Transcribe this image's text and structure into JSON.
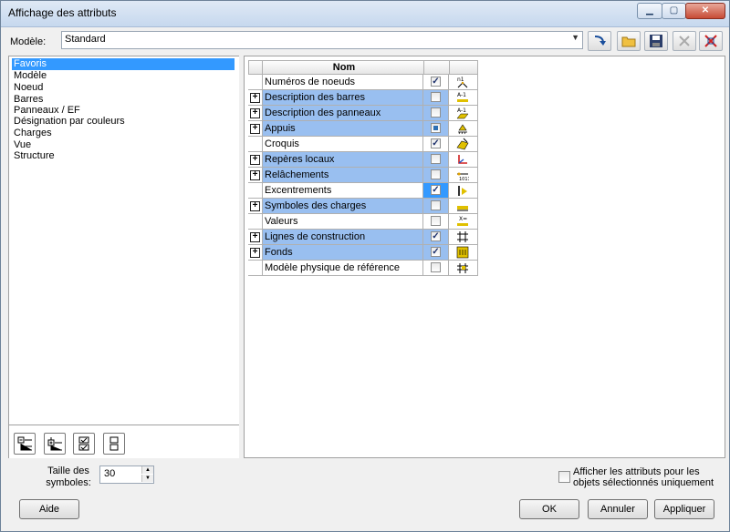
{
  "window": {
    "title": "Affichage des attributs"
  },
  "model": {
    "label": "Modèle:",
    "value": "Standard"
  },
  "toolbar": {
    "buttons": [
      "apply-arrow-icon",
      "folder-icon",
      "save-icon",
      "delete-icon",
      "delete-red-icon"
    ]
  },
  "tree": {
    "items": [
      "Favoris",
      "Modèle",
      "Noeud",
      "Barres",
      "Panneaux / EF",
      "Désignation par couleurs",
      "Charges",
      "Vue",
      "Structure"
    ],
    "selected": "Favoris"
  },
  "left_buttons": [
    "collapse-all-icon",
    "expand-all-icon",
    "check-all-icon",
    "uncheck-all-icon"
  ],
  "grid": {
    "header": "Nom",
    "rows": [
      {
        "name": "Numéros de noeuds",
        "checked": true,
        "expandable": false,
        "icon": "node-numbers-icon"
      },
      {
        "name": "Description des barres",
        "checked": false,
        "expandable": true,
        "icon": "bar-description-icon"
      },
      {
        "name": "Description des panneaux",
        "checked": false,
        "expandable": true,
        "icon": "panel-description-icon"
      },
      {
        "name": "Appuis",
        "checked": "partial",
        "expandable": true,
        "icon": "supports-icon"
      },
      {
        "name": "Croquis",
        "checked": true,
        "expandable": false,
        "icon": "sketch-icon"
      },
      {
        "name": "Repères locaux",
        "checked": false,
        "expandable": true,
        "icon": "local-axes-icon"
      },
      {
        "name": "Relâchements",
        "checked": false,
        "expandable": true,
        "icon": "releases-icon"
      },
      {
        "name": "Excentrements",
        "checked": true,
        "expandable": false,
        "icon": "offsets-icon"
      },
      {
        "name": "Symboles des charges",
        "checked": false,
        "expandable": true,
        "icon": "load-symbols-icon"
      },
      {
        "name": "Valeurs",
        "checked": false,
        "expandable": false,
        "icon": "values-icon"
      },
      {
        "name": "Lignes de construction",
        "checked": true,
        "expandable": true,
        "icon": "construction-lines-icon"
      },
      {
        "name": "Fonds",
        "checked": true,
        "expandable": true,
        "icon": "backgrounds-icon"
      },
      {
        "name": "Modèle physique de référence",
        "checked": false,
        "expandable": false,
        "icon": "physical-model-icon"
      }
    ]
  },
  "symbol_size": {
    "label_line1": "Taille des",
    "label_line2": "symboles:",
    "value": "30"
  },
  "option": {
    "label_line1": "Afficher les attributs pour les",
    "label_line2": "objets sélectionnés uniquement",
    "checked": false
  },
  "buttons": {
    "help": "Aide",
    "ok": "OK",
    "cancel": "Annuler",
    "apply": "Appliquer"
  },
  "colors": {
    "row_blue": "#99bff0",
    "selection": "#3399ff"
  }
}
